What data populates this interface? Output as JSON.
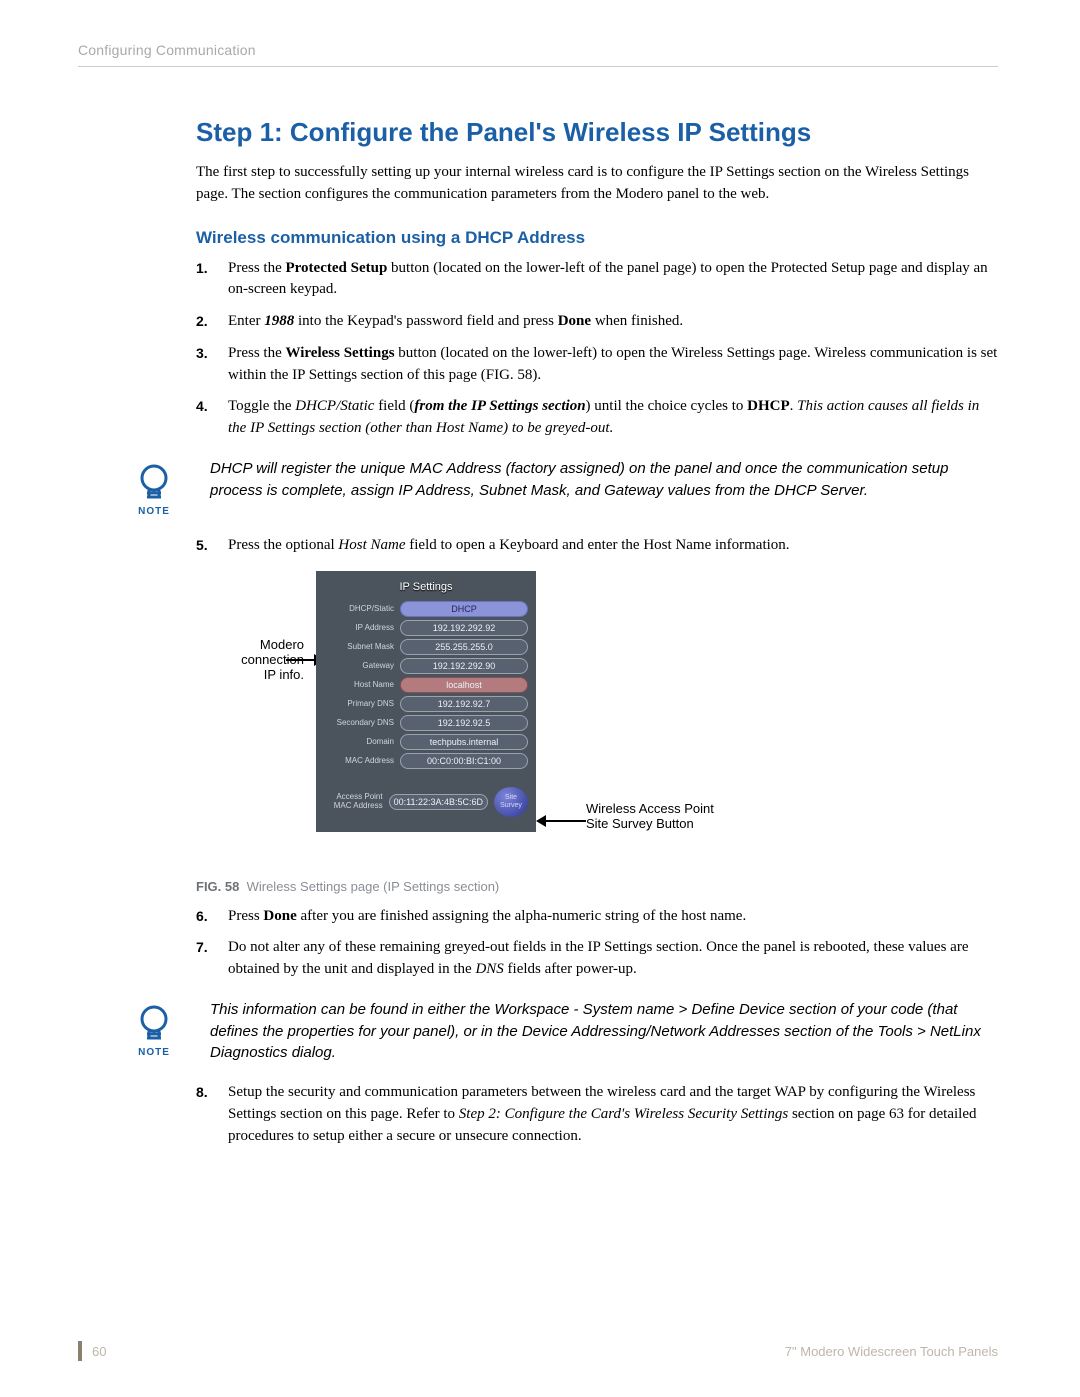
{
  "running_head": "Configuring Communication",
  "title": "Step 1: Configure the Panel's Wireless IP Settings",
  "intro": "The first step to successfully setting up your internal wireless card is to configure the IP Settings section on the Wireless Settings page. The section configures the communication parameters from the Modero panel to the web.",
  "subhead": "Wireless communication using a DHCP Address",
  "steps": {
    "s1": {
      "num": "1.",
      "a": "Press the ",
      "b": "Protected Setup",
      "c": " button (located on the lower-left of the panel page) to open the Protected Setup page and display an on-screen keypad."
    },
    "s2": {
      "num": "2.",
      "a": "Enter ",
      "b": "1988",
      "c": " into the Keypad's password field and press ",
      "d": "Done",
      "e": " when finished."
    },
    "s3": {
      "num": "3.",
      "a": "Press the ",
      "b": "Wireless Settings",
      "c": " button (located on the lower-left) to open the Wireless Settings page. Wireless communication is set within the IP Settings section of this page (FIG. 58)."
    },
    "s4": {
      "num": "4.",
      "a": "Toggle the ",
      "b": "DHCP/Static",
      "c": " field (",
      "d": "from the IP Settings section",
      "e": ") until the choice cycles to ",
      "f": "DHCP",
      "g": ". ",
      "h": "This action causes all fields in the IP Settings section (other than Host Name) to be greyed-out."
    },
    "s5": {
      "num": "5.",
      "a": "Press the optional ",
      "b": "Host Name",
      "c": " field to open a Keyboard and enter the Host Name information."
    },
    "s6": {
      "num": "6.",
      "a": "Press ",
      "b": "Done",
      "c": " after you are finished assigning the alpha-numeric string of the host name."
    },
    "s7": {
      "num": "7.",
      "a": "Do not alter any of these remaining greyed-out fields in the IP Settings section. Once the panel is rebooted, these values are obtained by the unit and displayed in the ",
      "b": "DNS",
      "c": " fields after power-up."
    },
    "s8": {
      "num": "8.",
      "a": "Setup the security and communication parameters between the wireless card and the target WAP by configuring the Wireless Settings section on this page. Refer to ",
      "b": "Step 2: Configure the Card's Wireless Security Settings",
      "c": " section on page 63 for detailed procedures to setup either a secure or unsecure connection."
    }
  },
  "note1": "DHCP will register the unique MAC Address (factory assigned) on the panel and once the communication setup process is complete, assign IP Address, Subnet Mask, and Gateway values from the DHCP Server.",
  "note2": "This information can be found in either the Workspace - System name > Define Device section of your code (that defines the properties for your panel), or in the Device Addressing/Network Addresses section of the Tools > NetLinx Diagnostics dialog.",
  "note_label": "NOTE",
  "figure": {
    "title": "IP Settings",
    "rows": {
      "dhcp": {
        "label": "DHCP/Static",
        "value": "DHCP"
      },
      "ip": {
        "label": "IP Address",
        "value": "192.192.292.92"
      },
      "subnet": {
        "label": "Subnet Mask",
        "value": "255.255.255.0"
      },
      "gw": {
        "label": "Gateway",
        "value": "192.192.292.90"
      },
      "host": {
        "label": "Host Name",
        "value": "localhost"
      },
      "dns1": {
        "label": "Primary DNS",
        "value": "192.192.92.7"
      },
      "dns2": {
        "label": "Secondary DNS",
        "value": "192.192.92.5"
      },
      "domain": {
        "label": "Domain",
        "value": "techpubs.internal"
      },
      "mac": {
        "label": "MAC Address",
        "value": "00:C0:00:BI:C1:00"
      },
      "apmac": {
        "label": "Access Point MAC Address",
        "value": "00:11:22:3A:4B:5C:6D"
      }
    },
    "survey_btn": "Site Survey",
    "callout_left_1": "Modero",
    "callout_left_2": "connection",
    "callout_left_3": "IP info.",
    "callout_right_1": "Wireless Access Point",
    "callout_right_2": "Site Survey Button",
    "caption_tag": "FIG. 58",
    "caption_text": "Wireless Settings page (IP Settings section)"
  },
  "footer": {
    "page": "60",
    "product": "7\" Modero Widescreen Touch Panels"
  }
}
